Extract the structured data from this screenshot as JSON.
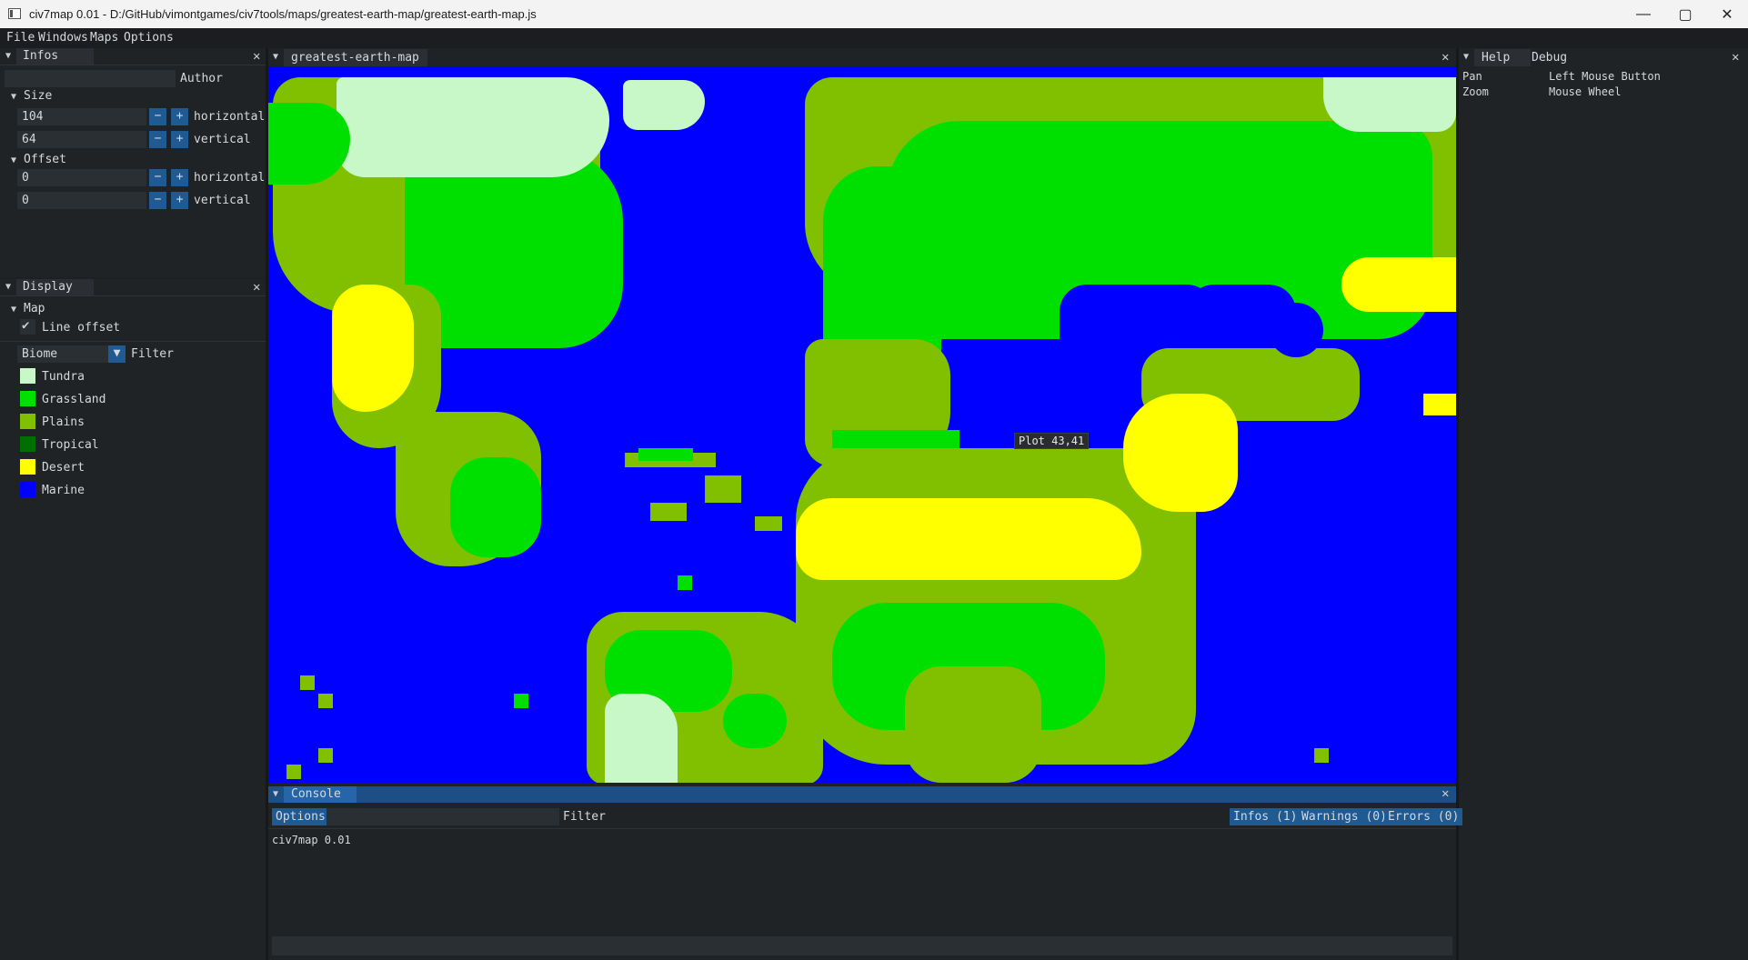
{
  "window": {
    "title": "civ7map 0.01 - D:/GitHub/vimontgames/civ7tools/maps/greatest-earth-map/greatest-earth-map.js",
    "controls": {
      "minimize": "—",
      "maximize": "▢",
      "close": "✕"
    }
  },
  "menu": {
    "items": [
      "File",
      "Windows",
      "Maps",
      "Options"
    ]
  },
  "infos_panel": {
    "title": "Infos",
    "author_label": "Author",
    "author_value": "",
    "size": {
      "header": "Size",
      "horizontal_value": "104",
      "horizontal_label": "horizontal",
      "vertical_value": "64",
      "vertical_label": "vertical"
    },
    "offset": {
      "header": "Offset",
      "horizontal_value": "0",
      "horizontal_label": "horizontal",
      "vertical_value": "0",
      "vertical_label": "vertical"
    },
    "minus": "−",
    "plus": "+"
  },
  "display_panel": {
    "title": "Display",
    "map_header": "Map",
    "line_offset_label": "Line offset",
    "line_offset_checked": true,
    "filter_select_value": "Biome",
    "filter_label": "Filter",
    "biomes": [
      {
        "label": "Tundra",
        "color": "#c8f7c8"
      },
      {
        "label": "Grassland",
        "color": "#00e000"
      },
      {
        "label": "Plains",
        "color": "#80c000"
      },
      {
        "label": "Tropical",
        "color": "#006e00"
      },
      {
        "label": "Desert",
        "color": "#ffff00"
      },
      {
        "label": "Marine",
        "color": "#0000ff"
      }
    ]
  },
  "map_tab": {
    "title": "greatest-earth-map",
    "tooltip": "Plot 43,41"
  },
  "help_panel": {
    "tabs": [
      "Help",
      "Debug"
    ],
    "rows": [
      {
        "action": "Pan",
        "binding": "Left Mouse Button"
      },
      {
        "action": "Zoom",
        "binding": "Mouse Wheel"
      }
    ]
  },
  "console": {
    "title": "Console",
    "options_label": "Options",
    "filter_value": "",
    "filter_label": "Filter",
    "infos_btn": "Infos (1)",
    "warnings_btn": "Warnings (0)",
    "errors_btn": "Errors (0)",
    "log": [
      "civ7map 0.01"
    ]
  },
  "colors": {
    "accent": "#1f5a93",
    "console_header": "#1c4f86",
    "marine": "#0000ff"
  }
}
